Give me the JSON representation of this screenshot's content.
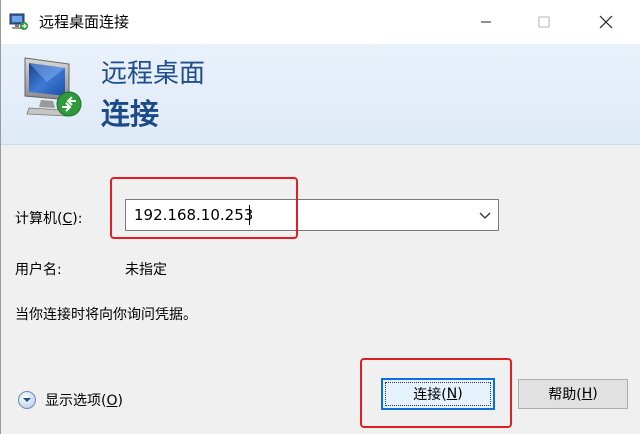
{
  "window": {
    "title": "远程桌面连接"
  },
  "banner": {
    "line1": "远程桌面",
    "line2": "连接"
  },
  "form": {
    "computer_label": "计算机(",
    "computer_mnemonic": "C",
    "computer_label_end": "):",
    "computer_value": "192.168.10.253",
    "username_label": "用户名:",
    "username_value": "未指定",
    "note": "当你连接时将向你询问凭据。"
  },
  "footer": {
    "options_label": "显示选项(",
    "options_mnemonic": "O",
    "options_label_end": ")",
    "connect_label": "连接(",
    "connect_mnemonic": "N",
    "connect_label_end": ")",
    "help_label": "帮助(",
    "help_mnemonic": "H",
    "help_label_end": ")"
  },
  "colors": {
    "banner_text": "#1f4e8c",
    "highlight": "#e02020",
    "default_button_border": "#0a6fd6"
  }
}
